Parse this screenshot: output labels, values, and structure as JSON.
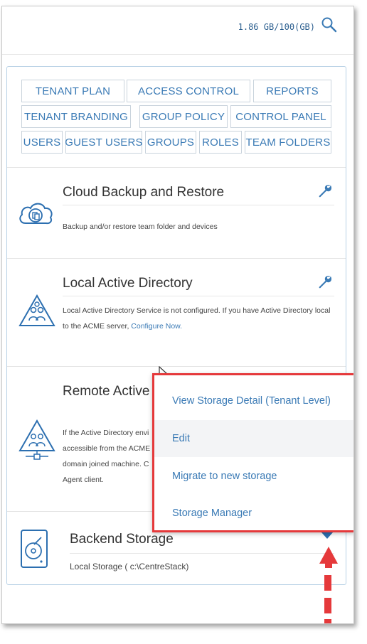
{
  "header": {
    "storage_usage": "1.86 GB/100(GB)",
    "search_icon": "search-icon"
  },
  "tabs": [
    {
      "label": "TENANT PLAN"
    },
    {
      "label": "ACCESS CONTROL"
    },
    {
      "label": "REPORTS"
    },
    {
      "label": "TENANT BRANDING"
    },
    {
      "label": "GROUP POLICY"
    },
    {
      "label": "CONTROL PANEL"
    },
    {
      "label": "USERS"
    },
    {
      "label": "GUEST USERS"
    },
    {
      "label": "GROUPS"
    },
    {
      "label": "ROLES"
    },
    {
      "label": "TEAM FOLDERS"
    }
  ],
  "services": {
    "cloud_backup": {
      "title": "Cloud Backup and Restore",
      "description": "Backup and/or restore team folder and devices",
      "icon": "cloud-backup-icon"
    },
    "local_ad": {
      "title": "Local Active Directory",
      "description": "Local Active Directory Service is not configured. If you have Active Directory local to the ACME server,",
      "link": "Configure Now.",
      "icon": "active-directory-icon"
    },
    "remote_ad": {
      "title": "Remote Active",
      "desc_line1": "If the Active Directory envi",
      "desc_line2": "accessible from the ACME",
      "desc_line3": "domain joined machine. C",
      "desc_line4": "Agent client.",
      "icon": "remote-directory-icon"
    },
    "backend_storage": {
      "title": "Backend Storage",
      "description": "Local Storage ( c:\\CentreStack)",
      "icon": "hard-drive-icon"
    }
  },
  "menu": {
    "items": [
      {
        "label": "View Storage Detail (Tenant Level)"
      },
      {
        "label": "Edit"
      },
      {
        "label": "Migrate to new storage"
      },
      {
        "label": "Storage Manager"
      }
    ]
  },
  "colors": {
    "accent": "#3a7ab5",
    "annotation": "#e5393b",
    "border": "#b9d2e6"
  }
}
